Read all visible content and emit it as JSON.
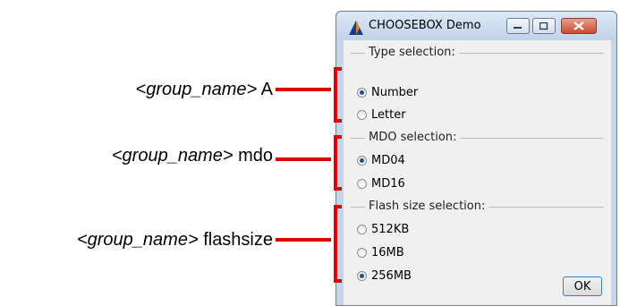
{
  "window": {
    "title": "CHOOSEBOX Demo",
    "controls": {
      "minimize": "minimize",
      "maximize": "maximize",
      "close": "close"
    }
  },
  "groups": [
    {
      "label": "Type selection:",
      "options": [
        {
          "label": "Number",
          "selected": true
        },
        {
          "label": "Letter",
          "selected": false
        }
      ]
    },
    {
      "label": "MDO selection:",
      "options": [
        {
          "label": "MD04",
          "selected": true
        },
        {
          "label": "MD16",
          "selected": false
        }
      ]
    },
    {
      "label": "Flash size selection:",
      "options": [
        {
          "label": "512KB",
          "selected": false
        },
        {
          "label": "16MB",
          "selected": false
        },
        {
          "label": "256MB",
          "selected": true
        }
      ]
    }
  ],
  "ok_label": "OK",
  "annotations": [
    {
      "tag": "<group_name>",
      "name": "A"
    },
    {
      "tag": "<group_name>",
      "name": "mdo"
    },
    {
      "tag": "<group_name>",
      "name": "flashsize"
    }
  ],
  "colors": {
    "annotation": "#e00000",
    "radio_selected": "#1f4f8f"
  }
}
